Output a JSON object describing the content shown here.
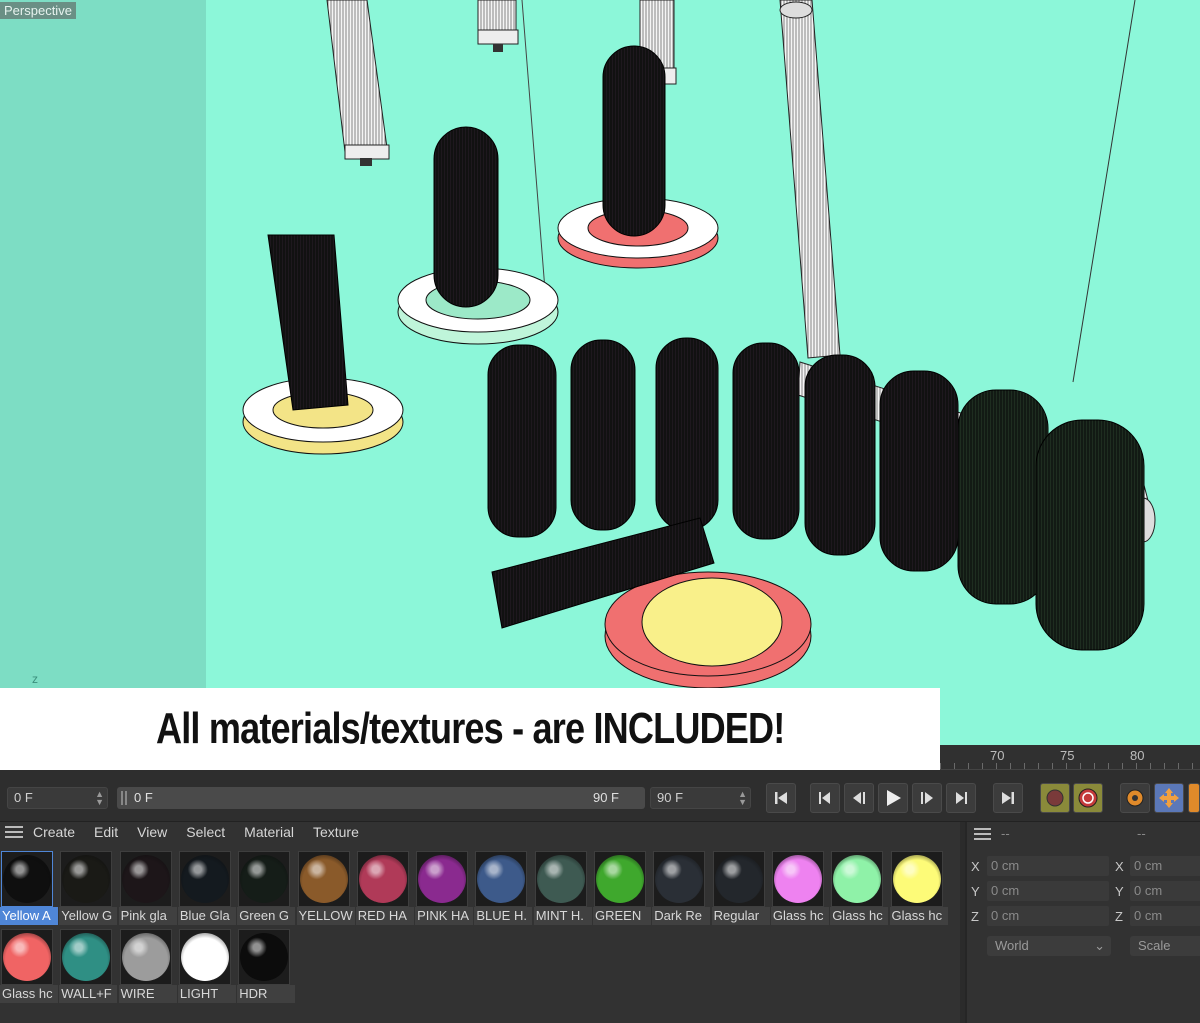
{
  "viewport": {
    "label": "Perspective",
    "axis_label": "z"
  },
  "banner": {
    "text": "All materials/textures  - are INCLUDED!"
  },
  "timeline": {
    "ruler": [
      "70",
      "75",
      "80"
    ]
  },
  "transport": {
    "current_frame": "0 F",
    "range_start": "0 F",
    "range_end": "90 F",
    "end_frame": "90 F",
    "buttons": [
      "go-to-start",
      "previous-key",
      "previous-frame",
      "play",
      "next-frame",
      "next-key",
      "go-to-end",
      "record",
      "autokey",
      "keyframe-settings",
      "move-tool",
      "rotate-tool"
    ]
  },
  "material_manager": {
    "menu": [
      "Create",
      "Edit",
      "View",
      "Select",
      "Material",
      "Texture"
    ],
    "materials": [
      {
        "label": "Yellow A",
        "color": "#0f0f0f",
        "selected": true
      },
      {
        "label": "Yellow G",
        "color": "#1a1a16"
      },
      {
        "label": "Pink gla",
        "color": "#1d1619"
      },
      {
        "label": "Blue Gla",
        "color": "#141a1f"
      },
      {
        "label": "Green G",
        "color": "#151d18"
      },
      {
        "label": "YELLOW",
        "color": "#8a5a2a"
      },
      {
        "label": "RED HA",
        "color": "#b03a58"
      },
      {
        "label": "PINK HA",
        "color": "#8a2a8f"
      },
      {
        "label": "BLUE H.",
        "color": "#3d5a8a"
      },
      {
        "label": "MINT H.",
        "color": "#3e5a52"
      },
      {
        "label": "GREEN",
        "color": "#3fa82d"
      },
      {
        "label": "Dark Re",
        "color": "#2a2f36"
      },
      {
        "label": "Regular",
        "color": "#23272c"
      },
      {
        "label": "Glass hc",
        "color": "#ee82f0"
      },
      {
        "label": "Glass hc",
        "color": "#8ff2a8"
      },
      {
        "label": "Glass hc",
        "color": "#fdfb78"
      },
      {
        "label": "Glass hc",
        "color": "#f06464"
      },
      {
        "label": "WALL+F",
        "color": "#2f8f84"
      },
      {
        "label": "WIRE",
        "color": "#9c9c9c"
      },
      {
        "label": "LIGHT",
        "color": "#ffffff"
      },
      {
        "label": "HDR",
        "color": "#0c0c0c"
      }
    ]
  },
  "coordinates": {
    "header_left": "--",
    "header_right": "--",
    "rows": [
      {
        "axis": "X",
        "pos": "0 cm",
        "axis2": "X",
        "size": "0 cm"
      },
      {
        "axis": "Y",
        "pos": "0 cm",
        "axis2": "Y",
        "size": "0 cm"
      },
      {
        "axis": "Z",
        "pos": "0 cm",
        "axis2": "Z",
        "size": "0 cm"
      }
    ],
    "space": "World",
    "mode": "Scale"
  }
}
